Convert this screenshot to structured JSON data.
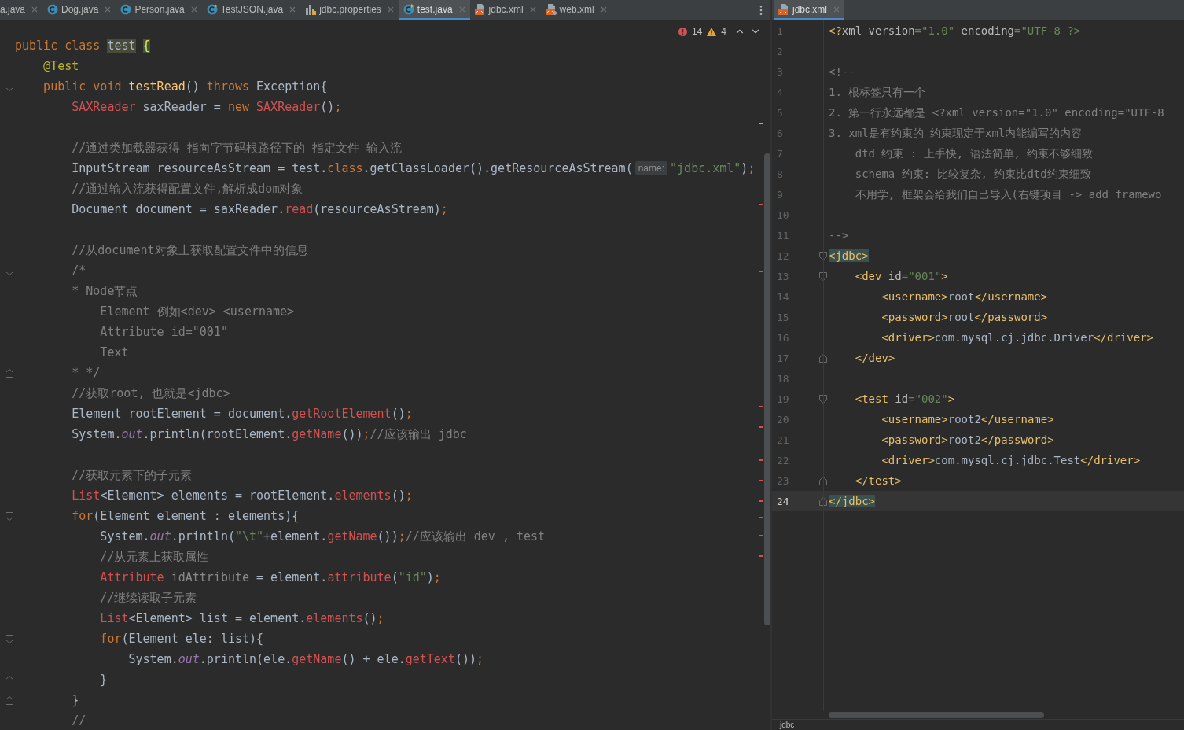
{
  "left_pane": {
    "tabs": [
      {
        "label": "a.java",
        "selected": false
      },
      {
        "label": "Dog.java",
        "kind": "class",
        "selected": false
      },
      {
        "label": "Person.java",
        "kind": "class",
        "selected": false
      },
      {
        "label": "TestJSON.java",
        "kind": "class-run",
        "selected": false
      },
      {
        "label": "jdbc.properties",
        "kind": "properties",
        "selected": false
      },
      {
        "label": "test.java",
        "kind": "class-run",
        "selected": true
      },
      {
        "label": "jdbc.xml",
        "kind": "xml",
        "selected": false
      },
      {
        "label": "web.xml",
        "kind": "web-xml",
        "selected": false
      }
    ],
    "inspections": {
      "errors": "14",
      "warnings": "4"
    },
    "lines": [
      {
        "kind": "code",
        "tokens": [
          {
            "kind": "kw",
            "text": "public class "
          },
          {
            "kind": "hl",
            "text": "test"
          },
          {
            "kind": "brace",
            "text": "{"
          }
        ]
      },
      {
        "kind": "code",
        "tokens": [
          {
            "kind": "ann",
            "text": "    @Test"
          }
        ]
      },
      {
        "kind": "fold-start",
        "tokens": [
          {
            "kind": "kw",
            "text": "    public void "
          },
          {
            "kind": "decl",
            "text": "testRead"
          },
          {
            "kind": "plain",
            "text": "() "
          },
          {
            "kind": "kw",
            "text": "throws "
          },
          {
            "kind": "plain",
            "text": "Exception{"
          }
        ]
      },
      {
        "kind": "code",
        "tokens": [
          {
            "kind": "err",
            "text": "        SAXReader"
          },
          {
            "kind": "plain",
            "text": " saxReader = "
          },
          {
            "kind": "kw",
            "text": "new "
          },
          {
            "kind": "err",
            "text": "SAXReader"
          },
          {
            "kind": "plain",
            "text": "()"
          },
          {
            "kind": "kw",
            "text": ";"
          }
        ]
      },
      {
        "kind": "blank"
      },
      {
        "kind": "code",
        "tokens": [
          {
            "kind": "cm",
            "text": "        //通过类加载器获得 指向字节码根路径下的 指定文件 输入流"
          }
        ]
      },
      {
        "kind": "code",
        "tokens": [
          {
            "kind": "plain",
            "text": "        InputStream resourceAsStream = test."
          },
          {
            "kind": "kw",
            "text": "class"
          },
          {
            "kind": "plain",
            "text": ".getClassLoader().getResourceAsStream("
          },
          {
            "kind": "hint",
            "text": "name:"
          },
          {
            "kind": "str",
            "text": "\"jdbc.xml\""
          },
          {
            "kind": "plain",
            "text": ")"
          },
          {
            "kind": "kw",
            "text": ";"
          }
        ]
      },
      {
        "kind": "code",
        "tokens": [
          {
            "kind": "cm",
            "text": "        //通过输入流获得配置文件,解析成dom对象"
          }
        ]
      },
      {
        "kind": "code",
        "tokens": [
          {
            "kind": "plain",
            "text": "        Document document = saxReader."
          },
          {
            "kind": "err",
            "text": "read"
          },
          {
            "kind": "plain",
            "text": "(resourceAsStream)"
          },
          {
            "kind": "kw",
            "text": ";"
          }
        ]
      },
      {
        "kind": "blank"
      },
      {
        "kind": "code",
        "tokens": [
          {
            "kind": "cm",
            "text": "        //从document对象上获取配置文件中的信息"
          }
        ]
      },
      {
        "kind": "fold-start",
        "tokens": [
          {
            "kind": "cm",
            "text": "        /*"
          }
        ]
      },
      {
        "kind": "code",
        "tokens": [
          {
            "kind": "cm",
            "text": "        * Node节点"
          }
        ]
      },
      {
        "kind": "code",
        "tokens": [
          {
            "kind": "cm",
            "text": "            Element 例如<dev> <username>"
          }
        ]
      },
      {
        "kind": "code",
        "tokens": [
          {
            "kind": "cm",
            "text": "            Attribute id=\"001\""
          }
        ]
      },
      {
        "kind": "code",
        "tokens": [
          {
            "kind": "cm",
            "text": "            Text"
          }
        ]
      },
      {
        "kind": "fold-end",
        "tokens": [
          {
            "kind": "cm",
            "text": "        * */"
          }
        ]
      },
      {
        "kind": "code",
        "tokens": [
          {
            "kind": "cm",
            "text": "        //获取root, 也就是<jdbc>"
          }
        ]
      },
      {
        "kind": "code",
        "tokens": [
          {
            "kind": "plain",
            "text": "        Element rootElement = document."
          },
          {
            "kind": "err",
            "text": "getRootElement"
          },
          {
            "kind": "plain",
            "text": "()"
          },
          {
            "kind": "kw",
            "text": ";"
          }
        ]
      },
      {
        "kind": "code",
        "tokens": [
          {
            "kind": "plain",
            "text": "        System."
          },
          {
            "kind": "fld",
            "text": "out"
          },
          {
            "kind": "plain",
            "text": ".println(rootElement."
          },
          {
            "kind": "err",
            "text": "getName"
          },
          {
            "kind": "plain",
            "text": "())"
          },
          {
            "kind": "kw",
            "text": ";"
          },
          {
            "kind": "cm",
            "text": "//应该输出 jdbc"
          }
        ]
      },
      {
        "kind": "blank"
      },
      {
        "kind": "code",
        "tokens": [
          {
            "kind": "cm",
            "text": "        //获取元素下的子元素"
          }
        ]
      },
      {
        "kind": "code",
        "tokens": [
          {
            "kind": "err",
            "text": "        List"
          },
          {
            "kind": "plain",
            "text": "<Element> elements = rootElement."
          },
          {
            "kind": "err",
            "text": "elements"
          },
          {
            "kind": "plain",
            "text": "()"
          },
          {
            "kind": "kw",
            "text": ";"
          }
        ]
      },
      {
        "kind": "fold-start",
        "tokens": [
          {
            "kind": "kw",
            "text": "        for"
          },
          {
            "kind": "plain",
            "text": "(Element element : elements){"
          }
        ]
      },
      {
        "kind": "code",
        "tokens": [
          {
            "kind": "plain",
            "text": "            System."
          },
          {
            "kind": "fld",
            "text": "out"
          },
          {
            "kind": "plain",
            "text": ".println("
          },
          {
            "kind": "str",
            "text": "\"\\t\""
          },
          {
            "kind": "plain",
            "text": "+element."
          },
          {
            "kind": "err",
            "text": "getName"
          },
          {
            "kind": "plain",
            "text": "())"
          },
          {
            "kind": "kw",
            "text": ";"
          },
          {
            "kind": "cm",
            "text": "//应该输出 dev , test"
          }
        ]
      },
      {
        "kind": "code",
        "tokens": [
          {
            "kind": "cm",
            "text": "            //从元素上获取属性"
          }
        ]
      },
      {
        "kind": "code",
        "tokens": [
          {
            "kind": "err",
            "text": "            Attribute"
          },
          {
            "kind": "dim",
            "text": " idAttribute"
          },
          {
            "kind": "plain",
            "text": " = element."
          },
          {
            "kind": "err",
            "text": "attribute"
          },
          {
            "kind": "plain",
            "text": "("
          },
          {
            "kind": "str",
            "text": "\"id\""
          },
          {
            "kind": "plain",
            "text": ")"
          },
          {
            "kind": "kw",
            "text": ";"
          }
        ]
      },
      {
        "kind": "code",
        "tokens": [
          {
            "kind": "cm",
            "text": "            //继续读取子元素"
          }
        ]
      },
      {
        "kind": "code",
        "tokens": [
          {
            "kind": "err",
            "text": "            List"
          },
          {
            "kind": "plain",
            "text": "<Element> list = element."
          },
          {
            "kind": "err",
            "text": "elements"
          },
          {
            "kind": "plain",
            "text": "()"
          },
          {
            "kind": "kw",
            "text": ";"
          }
        ]
      },
      {
        "kind": "fold-start",
        "tokens": [
          {
            "kind": "kw",
            "text": "            for"
          },
          {
            "kind": "plain",
            "text": "(Element ele: list){"
          }
        ]
      },
      {
        "kind": "code",
        "tokens": [
          {
            "kind": "plain",
            "text": "                System."
          },
          {
            "kind": "fld",
            "text": "out"
          },
          {
            "kind": "plain",
            "text": ".println(ele."
          },
          {
            "kind": "err",
            "text": "getName"
          },
          {
            "kind": "plain",
            "text": "() + ele."
          },
          {
            "kind": "err",
            "text": "getText"
          },
          {
            "kind": "plain",
            "text": "())"
          },
          {
            "kind": "kw",
            "text": ";"
          }
        ]
      },
      {
        "kind": "fold-end",
        "tokens": [
          {
            "kind": "plain",
            "text": "            }"
          }
        ]
      },
      {
        "kind": "fold-end",
        "tokens": [
          {
            "kind": "plain",
            "text": "        }"
          }
        ]
      },
      {
        "kind": "code",
        "tokens": [
          {
            "kind": "cm",
            "text": "        //"
          }
        ]
      }
    ]
  },
  "right_pane": {
    "tabs": [
      {
        "label": "jdbc.xml",
        "kind": "xml",
        "selected": true
      }
    ],
    "lines": [
      {
        "number": "1",
        "kind": "code",
        "current": false,
        "tokens": [
          {
            "kind": "tag",
            "text": "<?"
          },
          {
            "kind": "attr",
            "text": "xml version"
          },
          {
            "kind": "str",
            "text": "=\"1.0\""
          },
          {
            "kind": "attr",
            "text": " encoding"
          },
          {
            "kind": "str",
            "text": "=\"UTF-8 ?>"
          }
        ]
      },
      {
        "number": "2",
        "kind": "blank",
        "current": false
      },
      {
        "number": "3",
        "kind": "code",
        "current": false,
        "tokens": [
          {
            "kind": "cm",
            "text": "<!--"
          }
        ]
      },
      {
        "number": "4",
        "kind": "code",
        "current": false,
        "tokens": [
          {
            "kind": "cm",
            "text": "1. 根标签只有一个"
          }
        ]
      },
      {
        "number": "5",
        "kind": "code",
        "current": false,
        "tokens": [
          {
            "kind": "cm",
            "text": "2. 第一行永远都是 <?xml version=\"1.0\" encoding=\"UTF-8"
          }
        ]
      },
      {
        "number": "6",
        "kind": "code",
        "current": false,
        "tokens": [
          {
            "kind": "cm",
            "text": "3. xml是有约束的 约束现定于xml内能编写的内容"
          }
        ]
      },
      {
        "number": "7",
        "kind": "code",
        "current": false,
        "tokens": [
          {
            "kind": "cm",
            "text": "    dtd 约束 : 上手快, 语法简单, 约束不够细致"
          }
        ]
      },
      {
        "number": "8",
        "kind": "code",
        "current": false,
        "tokens": [
          {
            "kind": "cm",
            "text": "    schema 约束: 比较复杂, 约束比dtd约束细致"
          }
        ]
      },
      {
        "number": "9",
        "kind": "code",
        "current": false,
        "tokens": [
          {
            "kind": "cm",
            "text": "    不用学, 框架会给我们自己导入(右键项目 -> add framewo"
          }
        ]
      },
      {
        "number": "10",
        "kind": "blank",
        "current": false
      },
      {
        "number": "11",
        "kind": "code",
        "current": false,
        "tokens": [
          {
            "kind": "cm",
            "text": "-->"
          }
        ]
      },
      {
        "number": "12",
        "kind": "fold-start",
        "current": false,
        "tokens": [
          {
            "kind": "tagm",
            "text": "<jdbc>"
          }
        ]
      },
      {
        "number": "13",
        "kind": "fold-start",
        "current": false,
        "tokens": [
          {
            "kind": "tag",
            "text": "    <dev"
          },
          {
            "kind": "attr",
            "text": " id"
          },
          {
            "kind": "str",
            "text": "=\"001\""
          },
          {
            "kind": "tag",
            "text": ">"
          }
        ]
      },
      {
        "number": "14",
        "kind": "code",
        "current": false,
        "tokens": [
          {
            "kind": "tag",
            "text": "        <username>"
          },
          {
            "kind": "plain",
            "text": "root"
          },
          {
            "kind": "tag",
            "text": "</username>"
          }
        ]
      },
      {
        "number": "15",
        "kind": "code",
        "current": false,
        "tokens": [
          {
            "kind": "tag",
            "text": "        <password>"
          },
          {
            "kind": "plain",
            "text": "root"
          },
          {
            "kind": "tag",
            "text": "</password>"
          }
        ]
      },
      {
        "number": "16",
        "kind": "code",
        "current": false,
        "tokens": [
          {
            "kind": "tag",
            "text": "        <driver>"
          },
          {
            "kind": "plain",
            "text": "com.mysql.cj.jdbc.Driver"
          },
          {
            "kind": "tag",
            "text": "</driver>"
          }
        ]
      },
      {
        "number": "17",
        "kind": "fold-end",
        "current": false,
        "tokens": [
          {
            "kind": "tag",
            "text": "    </dev>"
          }
        ]
      },
      {
        "number": "18",
        "kind": "blank",
        "current": false
      },
      {
        "number": "19",
        "kind": "fold-start",
        "current": false,
        "tokens": [
          {
            "kind": "tag",
            "text": "    <test"
          },
          {
            "kind": "attr",
            "text": " id"
          },
          {
            "kind": "str",
            "text": "=\"002\""
          },
          {
            "kind": "tag",
            "text": ">"
          }
        ]
      },
      {
        "number": "20",
        "kind": "code",
        "current": false,
        "tokens": [
          {
            "kind": "tag",
            "text": "        <username>"
          },
          {
            "kind": "plain",
            "text": "root2"
          },
          {
            "kind": "tag",
            "text": "</username>"
          }
        ]
      },
      {
        "number": "21",
        "kind": "code",
        "current": false,
        "tokens": [
          {
            "kind": "tag",
            "text": "        <password>"
          },
          {
            "kind": "plain",
            "text": "root2"
          },
          {
            "kind": "tag",
            "text": "</password>"
          }
        ]
      },
      {
        "number": "22",
        "kind": "code",
        "current": false,
        "tokens": [
          {
            "kind": "tag",
            "text": "        <driver>"
          },
          {
            "kind": "plain",
            "text": "com.mysql.cj.jdbc.Test"
          },
          {
            "kind": "tag",
            "text": "</driver>"
          }
        ]
      },
      {
        "number": "23",
        "kind": "fold-end",
        "current": false,
        "tokens": [
          {
            "kind": "tag",
            "text": "    </test>"
          }
        ]
      },
      {
        "number": "24",
        "kind": "fold-end",
        "current": true,
        "tokens": [
          {
            "kind": "tagm",
            "text": "</jdbc>"
          }
        ]
      }
    ],
    "breadcrumb": "jdbc"
  }
}
